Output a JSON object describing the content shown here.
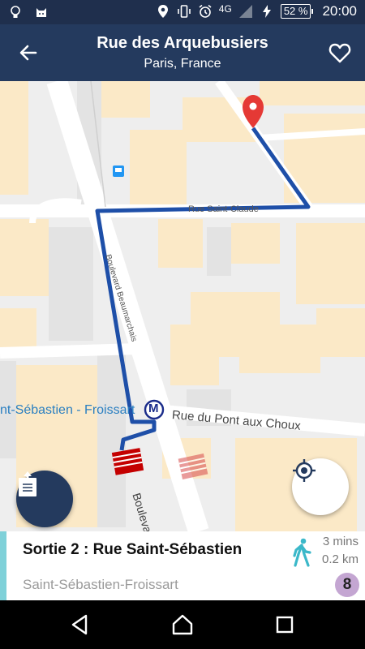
{
  "status_bar": {
    "network": "4G",
    "battery": "52 %",
    "time": "20:00"
  },
  "app_bar": {
    "title": "Rue des Arquebusiers",
    "subtitle": "Paris, France",
    "back_icon": "arrow-left-icon",
    "favorite_icon": "heart-outline-icon"
  },
  "map": {
    "street_labels": {
      "rue_saint_claude": "Rue Saint-Claude",
      "boulevard_beaumarchais": "Boulevard Beaumarchais",
      "rue_pont_aux_choux": "Rue du Pont aux Choux",
      "boulevard_filles": "Boulevard des Fill"
    },
    "station_label": "nt-Sébastien - Froissart",
    "metro_symbol": "M",
    "route_color": "#1e4fa8",
    "pin_color": "#e53935",
    "buttons": {
      "share_icon": "share-document-icon",
      "locate_icon": "my-location-icon"
    }
  },
  "route_card": {
    "exit_title": "Sortie 2 : Rue Saint-Sébastien",
    "station_name": "Saint-Sébastien-Froissart",
    "duration": "3 mins",
    "distance": "0.2 km",
    "metro_line": "8",
    "line_color": "#c4a6d2",
    "accent_color": "#7fd1d9"
  },
  "nav_bar": {
    "back_icon": "nav-back-icon",
    "home_icon": "nav-home-icon",
    "recents_icon": "nav-recents-icon"
  }
}
